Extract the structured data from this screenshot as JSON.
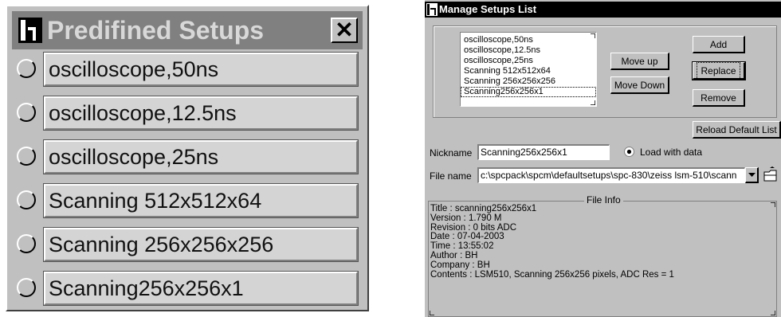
{
  "predefined": {
    "title": "Predifined Setups",
    "close_glyph": "✕",
    "items": [
      {
        "label": "oscilloscope,50ns"
      },
      {
        "label": "oscilloscope,12.5ns"
      },
      {
        "label": "oscilloscope,25ns"
      },
      {
        "label": "Scanning 512x512x64"
      },
      {
        "label": "Scanning 256x256x256"
      },
      {
        "label": "Scanning256x256x1"
      }
    ]
  },
  "manager": {
    "title": "Manage Setups List",
    "list": [
      {
        "label": "oscilloscope,50ns"
      },
      {
        "label": "oscilloscope,12.5ns"
      },
      {
        "label": "oscilloscope,25ns"
      },
      {
        "label": "Scanning 512x512x64"
      },
      {
        "label": "Scanning 256x256x256"
      },
      {
        "label": "Scanning256x256x1"
      }
    ],
    "selected_index": 5,
    "buttons": {
      "move_up": "Move up",
      "move_down": "Move Down",
      "add": "Add",
      "replace": "Replace",
      "remove": "Remove",
      "reload": "Reload Default List"
    },
    "nickname_label": "Nickname",
    "nickname_value": "Scanning256x256x1",
    "load_with_data_label": "Load with data",
    "filename_label": "File name",
    "filename_value": "c:\\spcpack\\spcm\\defaultsetups\\spc-830\\zeiss lsm-510\\scann",
    "file_info_legend": "File Info",
    "file_info": [
      "Title : scanning256x256x1",
      "Version : 1.790 M",
      "Revision : 0 bits ADC",
      "Date : 07-04-2003",
      "Time : 13:55:02",
      "Author : BH",
      "Company : BH",
      "Contents : LSM510, Scanning 256x256 pixels, ADC Res = 1"
    ]
  },
  "icons": [
    "app-icon",
    "close-icon",
    "radio-icon",
    "dropdown-arrow-icon",
    "browse-folder-icon"
  ]
}
